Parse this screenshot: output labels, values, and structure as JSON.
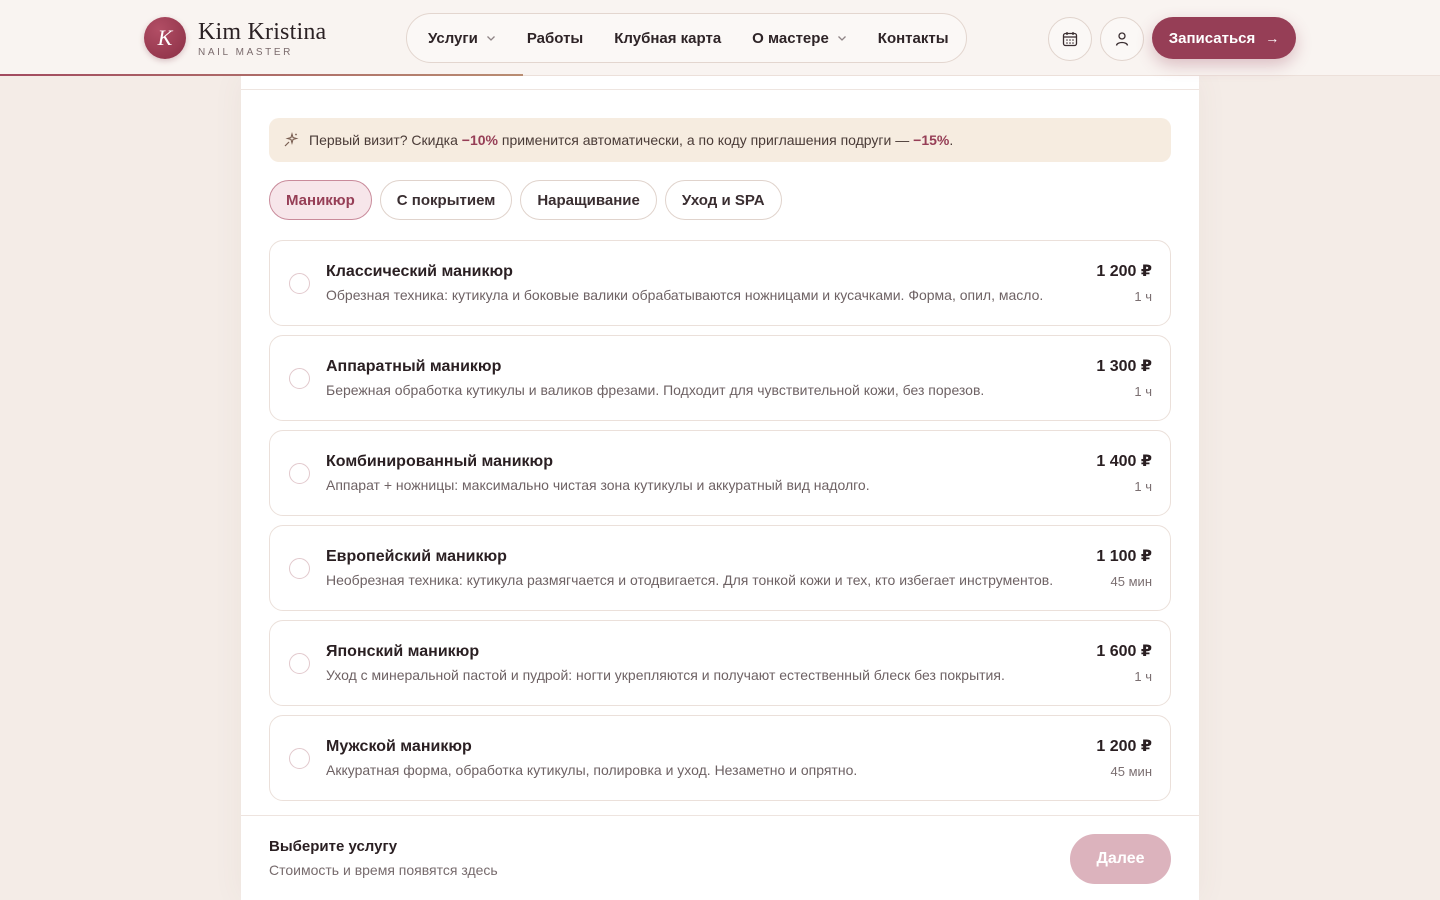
{
  "brand": {
    "initial": "K",
    "name": "Kim Kristina",
    "subtitle": "NAIL MASTER"
  },
  "nav": {
    "items": [
      {
        "label": "Услуги",
        "has_dropdown": true
      },
      {
        "label": "Работы",
        "has_dropdown": false
      },
      {
        "label": "Клубная карта",
        "has_dropdown": false
      },
      {
        "label": "О мастере",
        "has_dropdown": true
      },
      {
        "label": "Контакты",
        "has_dropdown": false
      }
    ]
  },
  "header": {
    "calendar_icon": "calendar-icon",
    "profile_icon": "user-icon",
    "cta_label": "Записаться",
    "cta_arrow": "→"
  },
  "promo": {
    "icon": "sparkle-icon",
    "text_1": "Первый визит? Скидка ",
    "discount_1": "−10%",
    "text_2": " применится автоматически, а по коду приглашения подруги — ",
    "discount_2": "−15%",
    "text_3": "."
  },
  "tabs": [
    {
      "label": "Маникюр",
      "active": true
    },
    {
      "label": "С покрытием",
      "active": false
    },
    {
      "label": "Наращивание",
      "active": false
    },
    {
      "label": "Уход и SPA",
      "active": false
    }
  ],
  "services": [
    {
      "name": "Классический маникюр",
      "description": "Обрезная техника: кутикула и боковые валики обрабатываются ножницами и кусачками. Форма, опил, масло.",
      "price": "1 200 ₽",
      "duration": "1 ч"
    },
    {
      "name": "Аппаратный маникюр",
      "description": "Бережная обработка кутикулы и валиков фрезами. Подходит для чувствительной кожи, без порезов.",
      "price": "1 300 ₽",
      "duration": "1 ч"
    },
    {
      "name": "Комбинированный маникюр",
      "description": "Аппарат + ножницы: максимально чистая зона кутикулы и аккуратный вид надолго.",
      "price": "1 400 ₽",
      "duration": "1 ч"
    },
    {
      "name": "Европейский маникюр",
      "description": "Необрезная техника: кутикула размягчается и отодвигается. Для тонкой кожи и тех, кто избегает инструментов.",
      "price": "1 100 ₽",
      "duration": "45 мин"
    },
    {
      "name": "Японский маникюр",
      "description": "Уход с минеральной пастой и пудрой: ногти укрепляются и получают естественный блеск без покрытия.",
      "price": "1 600 ₽",
      "duration": "1 ч"
    },
    {
      "name": "Мужской маникюр",
      "description": "Аккуратная форма, обработка кутикулы, полировка и уход. Незаметно и опрятно.",
      "price": "1 200 ₽",
      "duration": "45 мин"
    }
  ],
  "footer": {
    "title": "Выберите услугу",
    "subtitle": "Стоимость и время появятся здесь",
    "next_label": "Далее"
  },
  "colors": {
    "accent": "#963e56",
    "accent_soft": "#f7e6ea",
    "promo_bg": "#f6ece0",
    "disabled_button": "#dcb3bd"
  }
}
